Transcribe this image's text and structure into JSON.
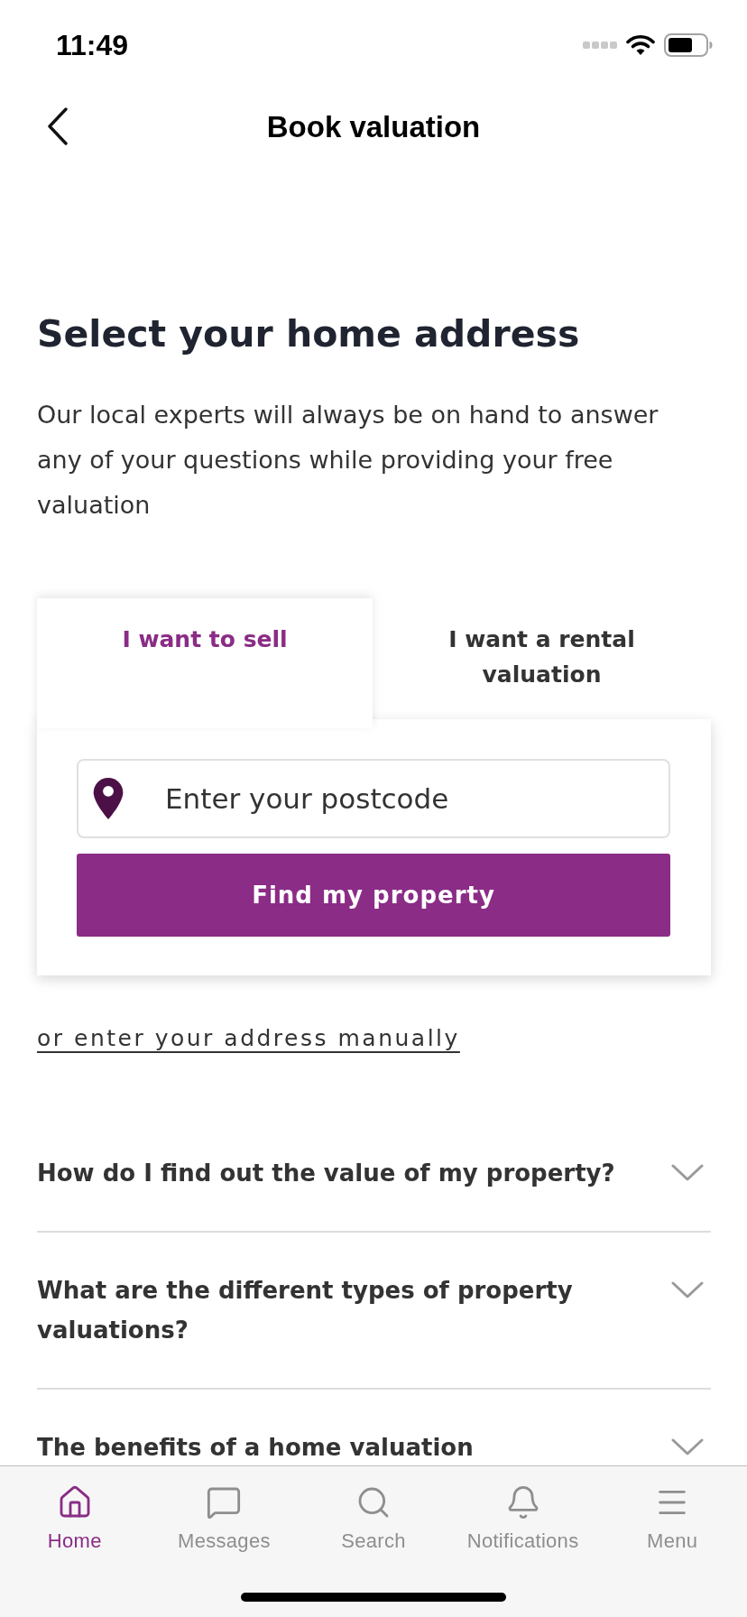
{
  "status_bar": {
    "time": "11:49"
  },
  "header": {
    "title": "Book valuation"
  },
  "intro": {
    "heading": "Select your home address",
    "text": "Our local experts will always be on hand to answer any of your questions while providing your free valuation"
  },
  "valuation_tabs": [
    {
      "label": "I want to sell",
      "selected": true
    },
    {
      "label": "I want a rental valuation",
      "selected": false
    }
  ],
  "postcode_field": {
    "placeholder": "Enter your postcode"
  },
  "find_button": {
    "label": "Find my property"
  },
  "manual_link": "or enter your address manually",
  "faqs": [
    {
      "question": "How do I find out the value of my property?",
      "expanded": false
    },
    {
      "question": "What are the different types of property valuations?",
      "expanded": false
    },
    {
      "question": "The benefits of a home valuation",
      "expanded": false
    }
  ],
  "tab_bar": [
    {
      "label": "Home",
      "selected": true
    },
    {
      "label": "Messages",
      "selected": false
    },
    {
      "label": "Search",
      "selected": false
    },
    {
      "label": "Notifications",
      "selected": false
    },
    {
      "label": "Menu",
      "selected": false
    }
  ]
}
